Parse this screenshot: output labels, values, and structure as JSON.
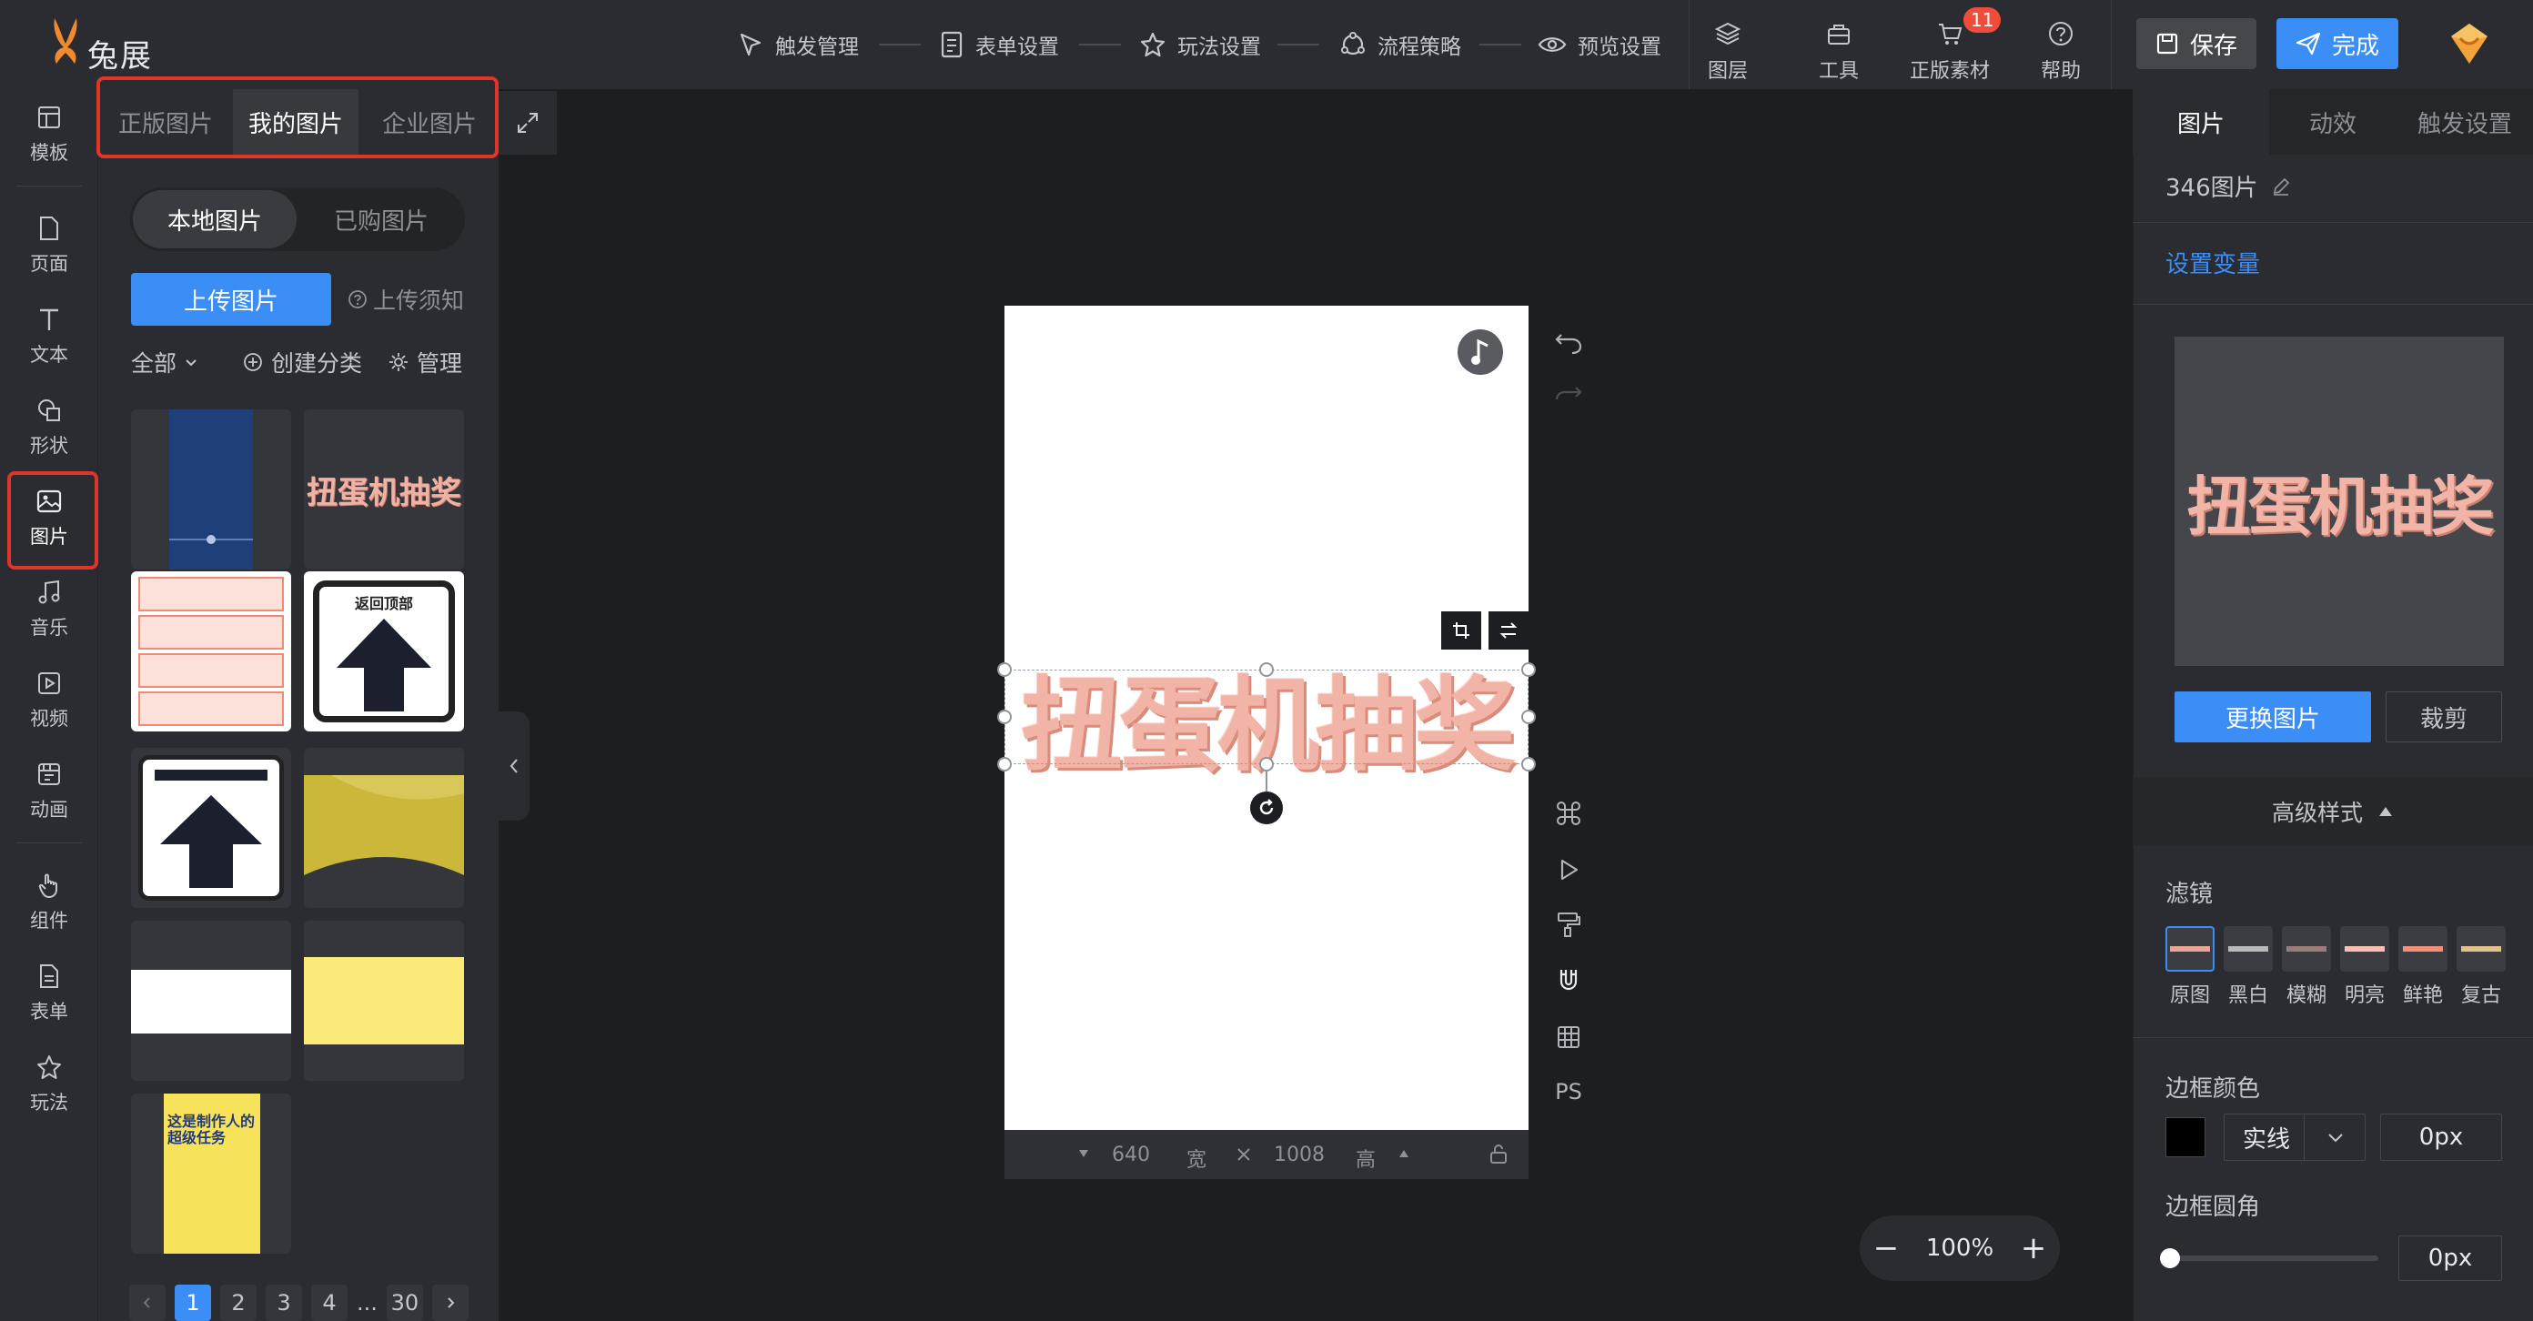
{
  "app": {
    "name": "兔展"
  },
  "topnav": [
    {
      "label": "触发管理",
      "icon": "trigger-icon"
    },
    {
      "label": "表单设置",
      "icon": "form-icon"
    },
    {
      "label": "玩法设置",
      "icon": "gameplay-icon"
    },
    {
      "label": "流程策略",
      "icon": "flow-icon"
    },
    {
      "label": "预览设置",
      "icon": "eye-icon"
    }
  ],
  "tools": [
    {
      "label": "图层",
      "icon": "layers-icon"
    },
    {
      "label": "工具",
      "icon": "toolbox-icon"
    },
    {
      "label": "正版素材",
      "icon": "cart-icon",
      "badge": "11"
    },
    {
      "label": "帮助",
      "icon": "help-icon"
    }
  ],
  "actions": {
    "save": "保存",
    "done": "完成"
  },
  "rail": [
    "模板",
    "页面",
    "文本",
    "形状",
    "图片",
    "音乐",
    "视频",
    "动画",
    "组件",
    "表单",
    "玩法"
  ],
  "panel": {
    "tabs": [
      "正版图片",
      "我的图片",
      "企业图片"
    ],
    "segments": [
      "本地图片",
      "已购图片"
    ],
    "upload": "上传图片",
    "upload_tip": "上传须知",
    "filter_all": "全部",
    "create_category": "创建分类",
    "manage": "管理",
    "thumb_text": {
      "gashapon": "扭蛋机抽奖",
      "back_top": "返回顶部",
      "poster": "这是制作人的超级任务"
    },
    "pages": [
      "1",
      "2",
      "3",
      "4",
      "...",
      "30"
    ]
  },
  "canvas": {
    "width": "640",
    "width_unit": "宽",
    "height": "1008",
    "height_unit": "高",
    "art_text": "扭蛋机抽奖",
    "side_ps": "PS"
  },
  "zoom": {
    "value": "100%",
    "minus": "−",
    "plus": "+"
  },
  "right": {
    "tabs": [
      "图片",
      "动效",
      "触发设置"
    ],
    "image_name": "346图片",
    "set_variable": "设置变量",
    "preview_text": "扭蛋机抽奖",
    "replace": "更换图片",
    "crop": "裁剪",
    "advanced": "高级样式",
    "filter_label": "滤镜",
    "filters": [
      "原图",
      "黑白",
      "模糊",
      "明亮",
      "鲜艳",
      "复古"
    ],
    "border_color_label": "边框颜色",
    "border_style": "实线",
    "border_width": "0px",
    "radius_label": "边框圆角",
    "radius_value": "0px",
    "radius_level": 0
  },
  "colors": {
    "accent": "#3a8ef6",
    "highlight": "#e0352b",
    "art": "#f2b4a6"
  }
}
